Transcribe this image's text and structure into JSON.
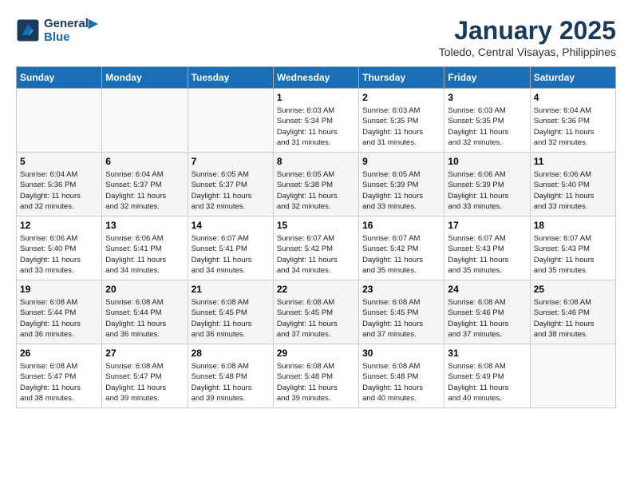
{
  "header": {
    "logo_line1": "General",
    "logo_line2": "Blue",
    "month": "January 2025",
    "location": "Toledo, Central Visayas, Philippines"
  },
  "weekdays": [
    "Sunday",
    "Monday",
    "Tuesday",
    "Wednesday",
    "Thursday",
    "Friday",
    "Saturday"
  ],
  "weeks": [
    [
      {
        "day": "",
        "info": ""
      },
      {
        "day": "",
        "info": ""
      },
      {
        "day": "",
        "info": ""
      },
      {
        "day": "1",
        "info": "Sunrise: 6:03 AM\nSunset: 5:34 PM\nDaylight: 11 hours\nand 31 minutes."
      },
      {
        "day": "2",
        "info": "Sunrise: 6:03 AM\nSunset: 5:35 PM\nDaylight: 11 hours\nand 31 minutes."
      },
      {
        "day": "3",
        "info": "Sunrise: 6:03 AM\nSunset: 5:35 PM\nDaylight: 11 hours\nand 32 minutes."
      },
      {
        "day": "4",
        "info": "Sunrise: 6:04 AM\nSunset: 5:36 PM\nDaylight: 11 hours\nand 32 minutes."
      }
    ],
    [
      {
        "day": "5",
        "info": "Sunrise: 6:04 AM\nSunset: 5:36 PM\nDaylight: 11 hours\nand 32 minutes."
      },
      {
        "day": "6",
        "info": "Sunrise: 6:04 AM\nSunset: 5:37 PM\nDaylight: 11 hours\nand 32 minutes."
      },
      {
        "day": "7",
        "info": "Sunrise: 6:05 AM\nSunset: 5:37 PM\nDaylight: 11 hours\nand 32 minutes."
      },
      {
        "day": "8",
        "info": "Sunrise: 6:05 AM\nSunset: 5:38 PM\nDaylight: 11 hours\nand 32 minutes."
      },
      {
        "day": "9",
        "info": "Sunrise: 6:05 AM\nSunset: 5:39 PM\nDaylight: 11 hours\nand 33 minutes."
      },
      {
        "day": "10",
        "info": "Sunrise: 6:06 AM\nSunset: 5:39 PM\nDaylight: 11 hours\nand 33 minutes."
      },
      {
        "day": "11",
        "info": "Sunrise: 6:06 AM\nSunset: 5:40 PM\nDaylight: 11 hours\nand 33 minutes."
      }
    ],
    [
      {
        "day": "12",
        "info": "Sunrise: 6:06 AM\nSunset: 5:40 PM\nDaylight: 11 hours\nand 33 minutes."
      },
      {
        "day": "13",
        "info": "Sunrise: 6:06 AM\nSunset: 5:41 PM\nDaylight: 11 hours\nand 34 minutes."
      },
      {
        "day": "14",
        "info": "Sunrise: 6:07 AM\nSunset: 5:41 PM\nDaylight: 11 hours\nand 34 minutes."
      },
      {
        "day": "15",
        "info": "Sunrise: 6:07 AM\nSunset: 5:42 PM\nDaylight: 11 hours\nand 34 minutes."
      },
      {
        "day": "16",
        "info": "Sunrise: 6:07 AM\nSunset: 5:42 PM\nDaylight: 11 hours\nand 35 minutes."
      },
      {
        "day": "17",
        "info": "Sunrise: 6:07 AM\nSunset: 5:43 PM\nDaylight: 11 hours\nand 35 minutes."
      },
      {
        "day": "18",
        "info": "Sunrise: 6:07 AM\nSunset: 5:43 PM\nDaylight: 11 hours\nand 35 minutes."
      }
    ],
    [
      {
        "day": "19",
        "info": "Sunrise: 6:08 AM\nSunset: 5:44 PM\nDaylight: 11 hours\nand 36 minutes."
      },
      {
        "day": "20",
        "info": "Sunrise: 6:08 AM\nSunset: 5:44 PM\nDaylight: 11 hours\nand 36 minutes."
      },
      {
        "day": "21",
        "info": "Sunrise: 6:08 AM\nSunset: 5:45 PM\nDaylight: 11 hours\nand 36 minutes."
      },
      {
        "day": "22",
        "info": "Sunrise: 6:08 AM\nSunset: 5:45 PM\nDaylight: 11 hours\nand 37 minutes."
      },
      {
        "day": "23",
        "info": "Sunrise: 6:08 AM\nSunset: 5:45 PM\nDaylight: 11 hours\nand 37 minutes."
      },
      {
        "day": "24",
        "info": "Sunrise: 6:08 AM\nSunset: 5:46 PM\nDaylight: 11 hours\nand 37 minutes."
      },
      {
        "day": "25",
        "info": "Sunrise: 6:08 AM\nSunset: 5:46 PM\nDaylight: 11 hours\nand 38 minutes."
      }
    ],
    [
      {
        "day": "26",
        "info": "Sunrise: 6:08 AM\nSunset: 5:47 PM\nDaylight: 11 hours\nand 38 minutes."
      },
      {
        "day": "27",
        "info": "Sunrise: 6:08 AM\nSunset: 5:47 PM\nDaylight: 11 hours\nand 39 minutes."
      },
      {
        "day": "28",
        "info": "Sunrise: 6:08 AM\nSunset: 5:48 PM\nDaylight: 11 hours\nand 39 minutes."
      },
      {
        "day": "29",
        "info": "Sunrise: 6:08 AM\nSunset: 5:48 PM\nDaylight: 11 hours\nand 39 minutes."
      },
      {
        "day": "30",
        "info": "Sunrise: 6:08 AM\nSunset: 5:48 PM\nDaylight: 11 hours\nand 40 minutes."
      },
      {
        "day": "31",
        "info": "Sunrise: 6:08 AM\nSunset: 5:49 PM\nDaylight: 11 hours\nand 40 minutes."
      },
      {
        "day": "",
        "info": ""
      }
    ]
  ]
}
